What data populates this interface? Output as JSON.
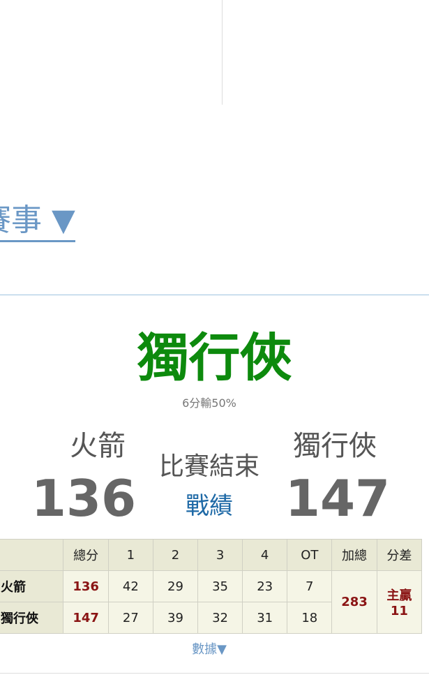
{
  "event_link": "賽事 ▼",
  "winner": "獨行俠",
  "odds_text": "6分輸50%",
  "home_team": "火箭",
  "away_team": "獨行俠",
  "home_score": "136",
  "away_score": "147",
  "status": "比賽結束",
  "record_link": "戰績",
  "boxscore": {
    "headers": [
      "",
      "總分",
      "1",
      "2",
      "3",
      "4",
      "OT",
      "加總",
      "分差"
    ],
    "rows": [
      {
        "team": "火箭",
        "total": "136",
        "q1": "42",
        "q2": "29",
        "q3": "35",
        "q4": "23",
        "ot": "7"
      },
      {
        "team": "獨行俠",
        "total": "147",
        "q1": "27",
        "q2": "39",
        "q3": "32",
        "q4": "31",
        "ot": "18"
      }
    ],
    "sum": "283",
    "diff_label": "主贏",
    "diff_value": "11"
  },
  "more_link": "數據▼",
  "colors": {
    "winner": "#0d8a0d",
    "link": "#6a97c5",
    "record": "#1e69a6",
    "total": "#8a1414"
  }
}
